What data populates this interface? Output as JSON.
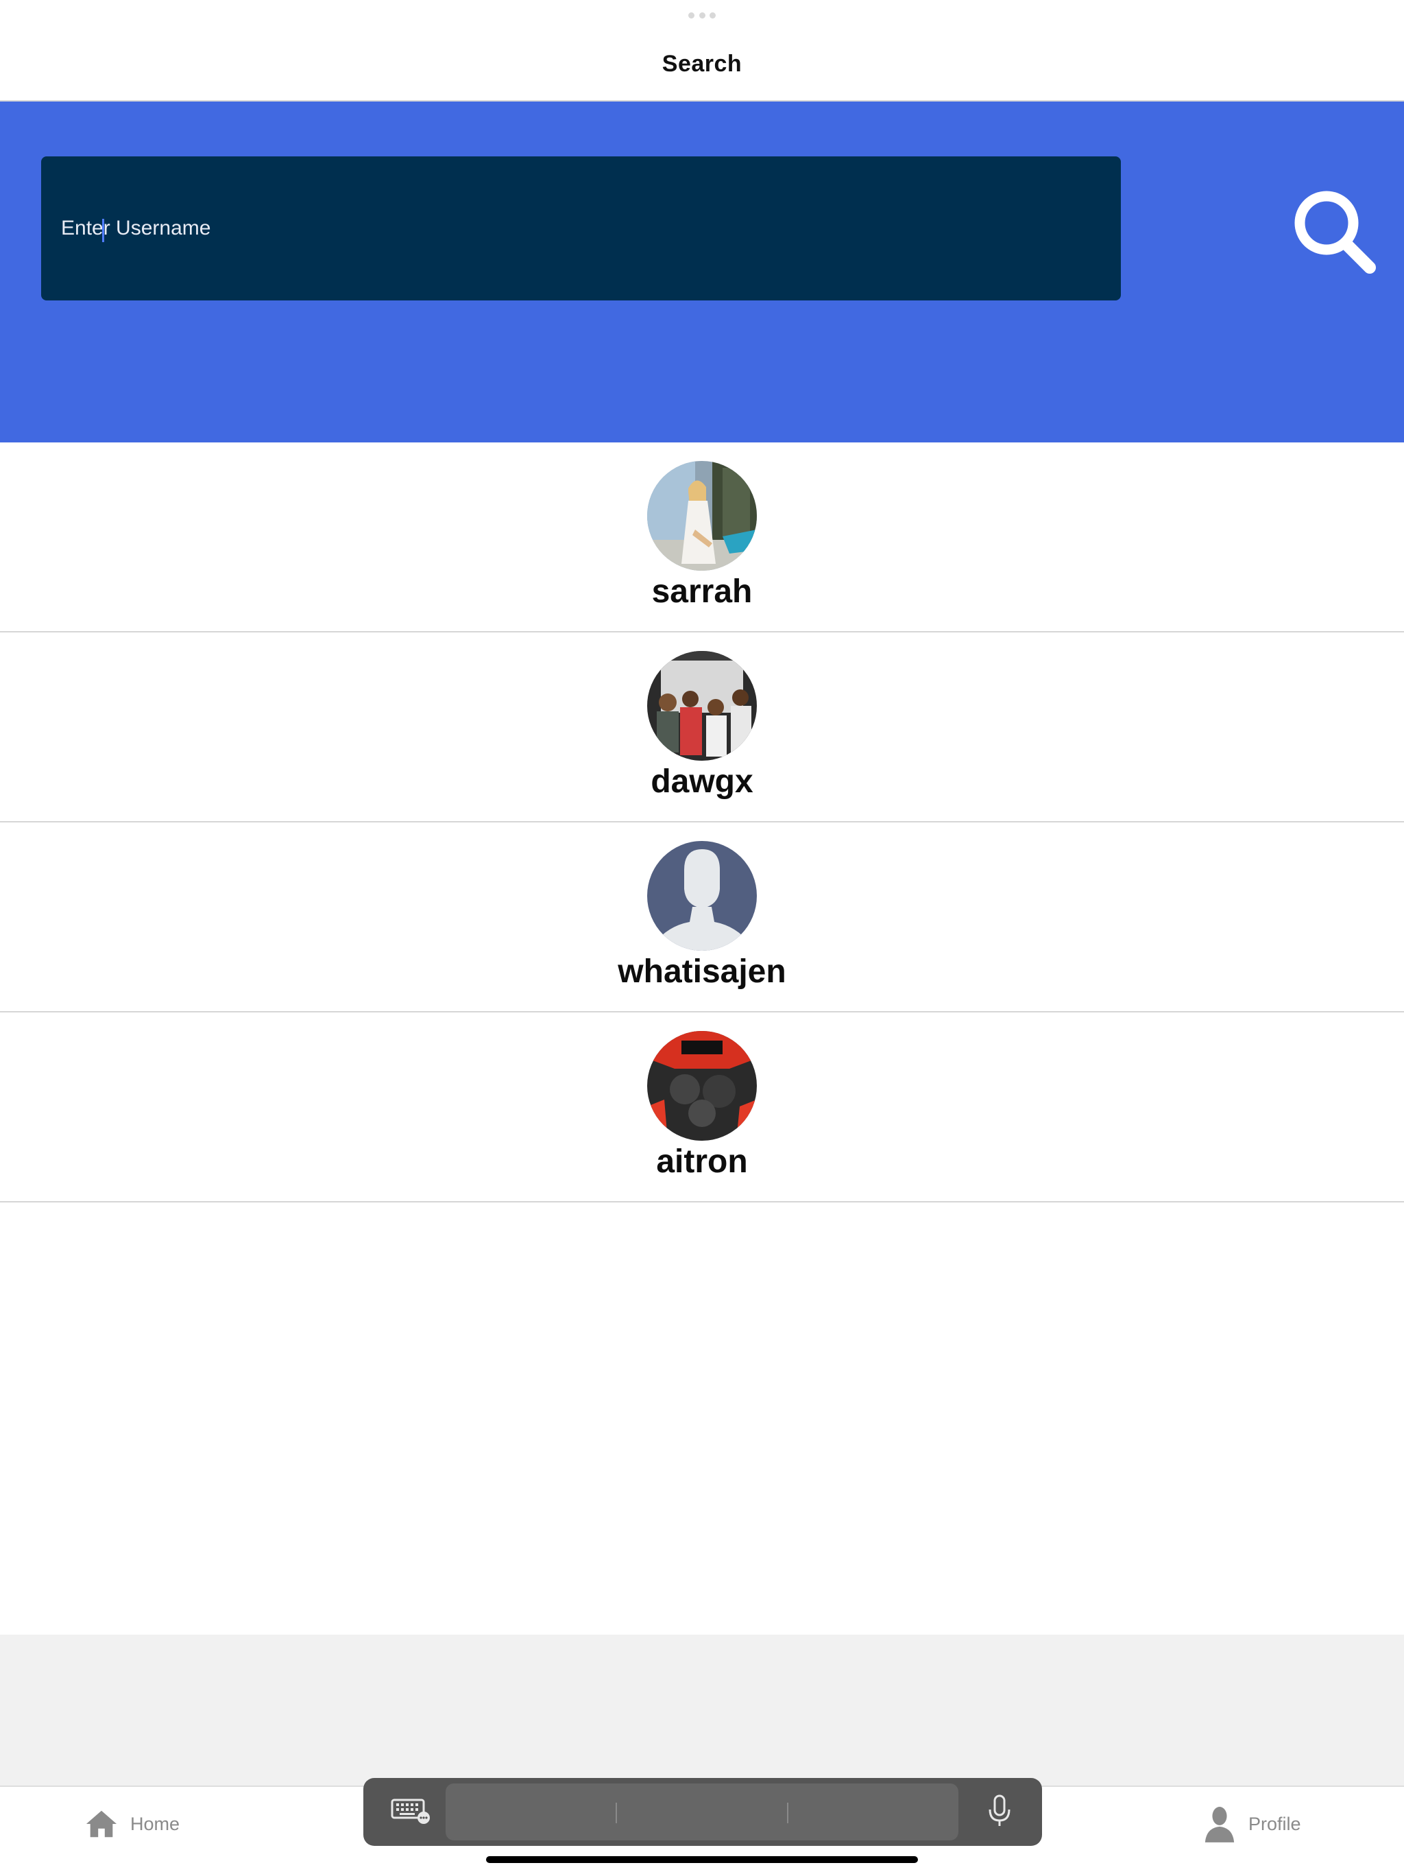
{
  "header": {
    "title": "Search"
  },
  "search": {
    "placeholder": "Enter Username",
    "value": "",
    "button_icon": "search-icon"
  },
  "users": [
    {
      "username": "sarrah",
      "avatar": "photo"
    },
    {
      "username": "dawgx",
      "avatar": "photo"
    },
    {
      "username": "whatisajen",
      "avatar": "default-person"
    },
    {
      "username": "aitron",
      "avatar": "photo"
    }
  ],
  "tab_bar": {
    "home_label": "Home",
    "profile_label": "Profile"
  },
  "keyboard_bar": {
    "keyboard_icon": "keyboard-icon",
    "mic_icon": "microphone-icon"
  },
  "colors": {
    "banner": "#4169e1",
    "input_background": "#002f4f",
    "tab_inactive": "#8a8a8a"
  }
}
